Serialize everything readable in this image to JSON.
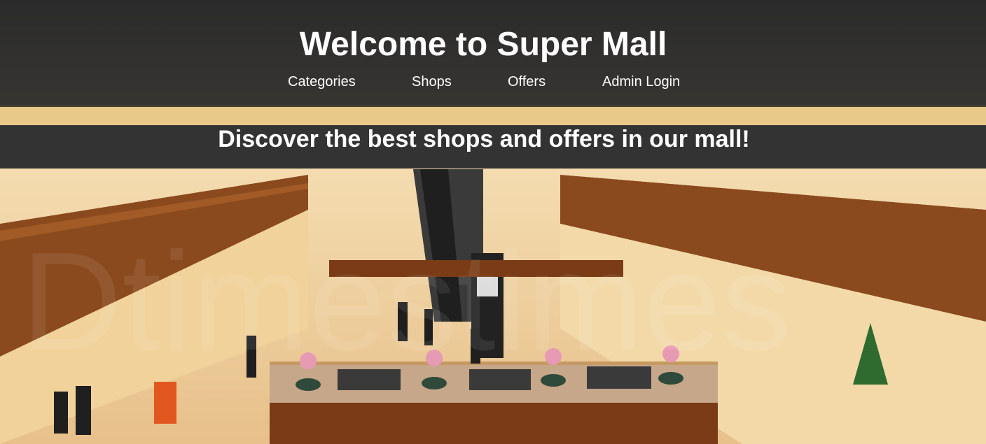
{
  "header": {
    "title": "Welcome to Super Mall",
    "nav": [
      {
        "label": "Categories"
      },
      {
        "label": "Shops"
      },
      {
        "label": "Offers"
      },
      {
        "label": "Admin Login"
      }
    ]
  },
  "banner": {
    "tagline": "Discover the best shops and offers in our mall!"
  },
  "colors": {
    "header_overlay": "#1c1c1c",
    "banner_background": "#333333",
    "text": "#ffffff"
  }
}
